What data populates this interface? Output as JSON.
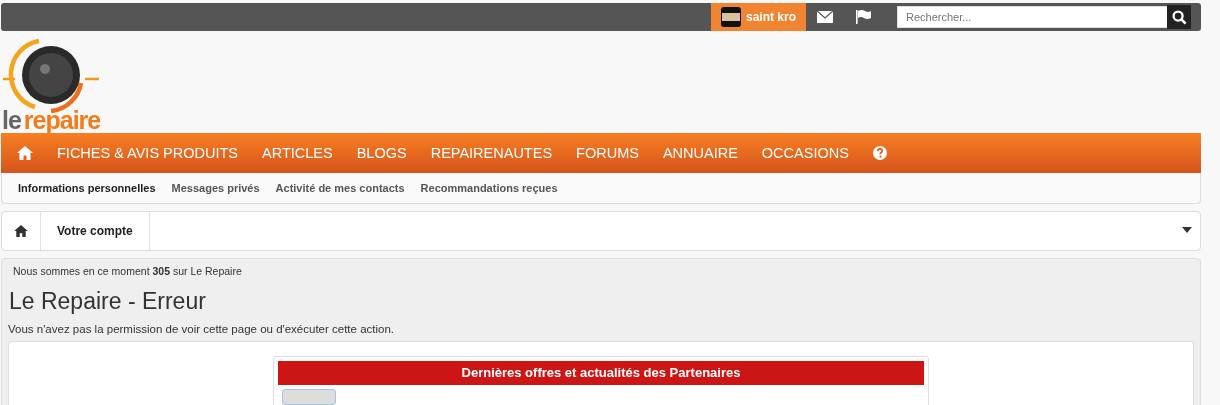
{
  "top_bar": {
    "user": "saint kro",
    "search": {
      "placeholder": "Rechercher..."
    }
  },
  "logo": {
    "word_1": "le",
    "word_2": "repaire"
  },
  "nav": {
    "items": [
      "FICHES & AVIS PRODUITS",
      "ARTICLES",
      "BLOGS",
      "REPAIRENAUTES",
      "FORUMS",
      "ANNUAIRE",
      "OCCASIONS"
    ]
  },
  "subnav": {
    "items": [
      {
        "label": "Informations personnelles",
        "selected": true
      },
      {
        "label": "Messages privés",
        "selected": false
      },
      {
        "label": "Activité de mes contacts",
        "selected": false
      },
      {
        "label": "Recommandations reçues",
        "selected": false
      }
    ]
  },
  "breadcrumb": {
    "items": [
      "Votre compte"
    ]
  },
  "content": {
    "online_notice": "Nous sommes en ce moment **305** sur Le Repaire",
    "title": "Le Repaire - Erreur",
    "message": "Vous n'avez pas la permission de voir cette page ou d'exécuter cette action.",
    "partners": {
      "title": "Dernières offres et actualités des Partenaires"
    }
  }
}
